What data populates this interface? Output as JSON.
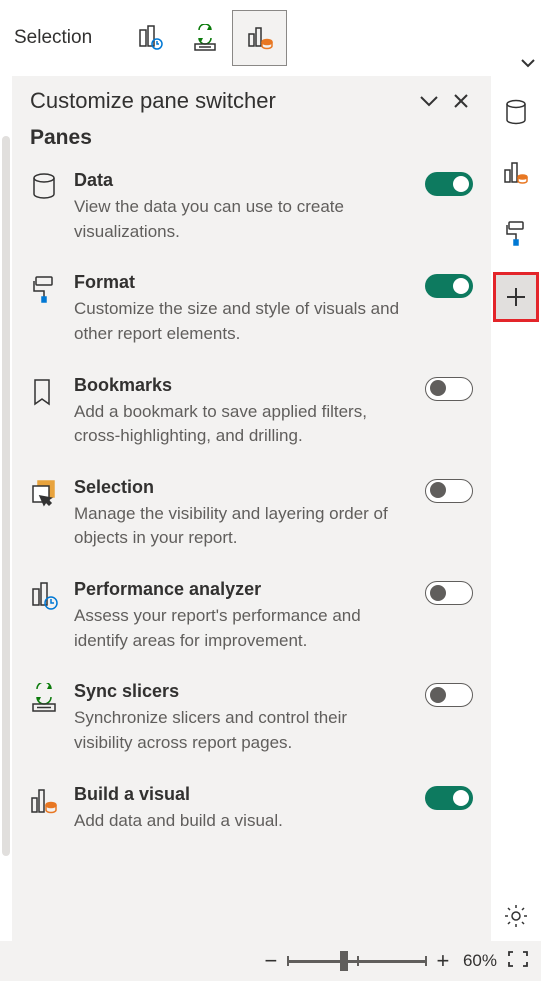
{
  "topbar": {
    "tab_label": "Selection"
  },
  "panel": {
    "title": "Customize pane switcher",
    "section": "Panes",
    "items": [
      {
        "name": "Data",
        "desc": "View the data you can use to create visualizations.",
        "on": true,
        "icon": "cylinder"
      },
      {
        "name": "Format",
        "desc": "Customize the size and style of visuals and other report elements.",
        "on": true,
        "icon": "roller"
      },
      {
        "name": "Bookmarks",
        "desc": "Add a bookmark to save applied filters, cross-highlighting, and drilling.",
        "on": false,
        "icon": "bookmark"
      },
      {
        "name": "Selection",
        "desc": "Manage the visibility and layering order of objects in your report.",
        "on": false,
        "icon": "layers"
      },
      {
        "name": "Performance analyzer",
        "desc": "Assess your report's performance and identify areas for improvement.",
        "on": false,
        "icon": "perf"
      },
      {
        "name": "Sync slicers",
        "desc": "Synchronize slicers and control their visibility across report pages.",
        "on": false,
        "icon": "sync"
      },
      {
        "name": "Build a visual",
        "desc": "Add data and build a visual.",
        "on": true,
        "icon": "build"
      }
    ]
  },
  "bottom": {
    "zoom_label": "60%"
  }
}
